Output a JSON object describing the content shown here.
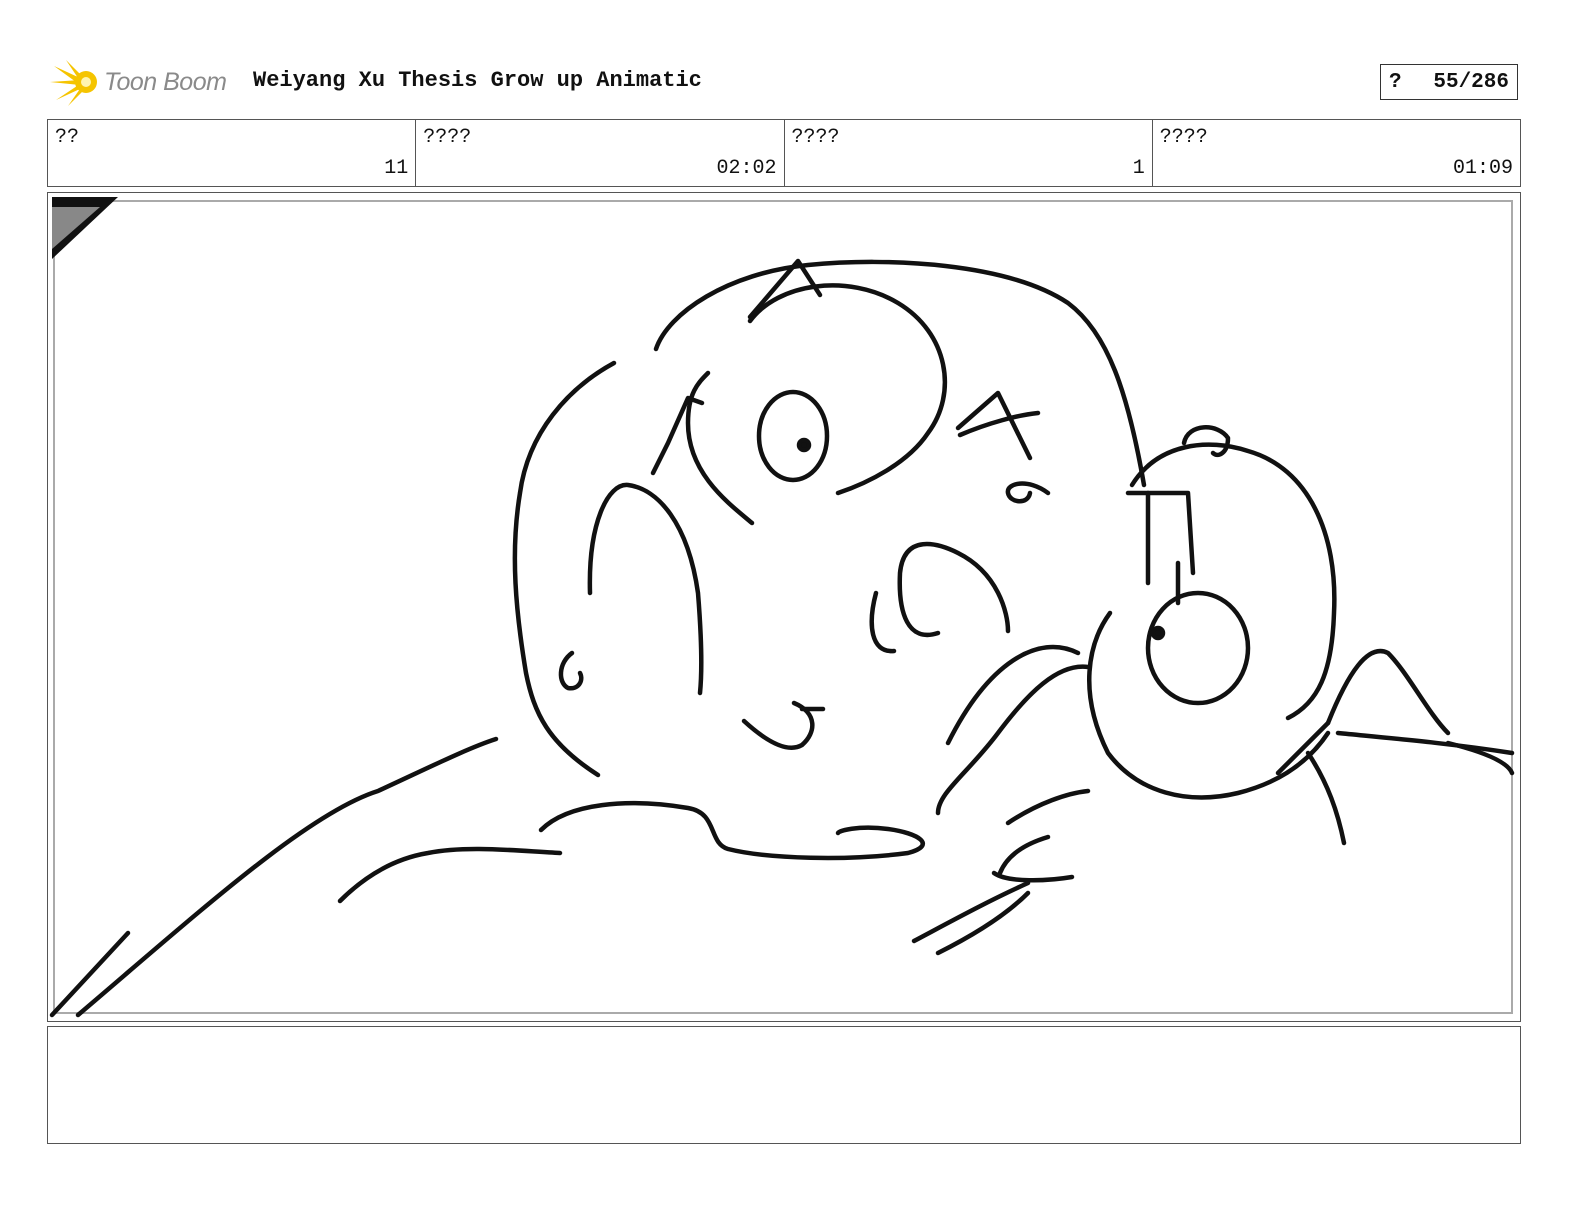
{
  "header": {
    "logo_text": "Toon Boom",
    "project_title": "Weiyang Xu Thesis Grow up Animatic",
    "page_prefix": "?",
    "page_number": "55/286"
  },
  "info": [
    {
      "label": "??",
      "value": "11"
    },
    {
      "label": "????",
      "value": "02:02"
    },
    {
      "label": "????",
      "value": "1"
    },
    {
      "label": "????",
      "value": "01:09"
    }
  ],
  "colors": {
    "logo_burst": "#f5c400",
    "logo_text": "#8a8a8a",
    "ink": "#111111",
    "corner_marker": "#888888"
  },
  "panel": {
    "image": "sketch of a character resting on a surface with a small bug-like creature"
  },
  "notes": {
    "text": ""
  }
}
